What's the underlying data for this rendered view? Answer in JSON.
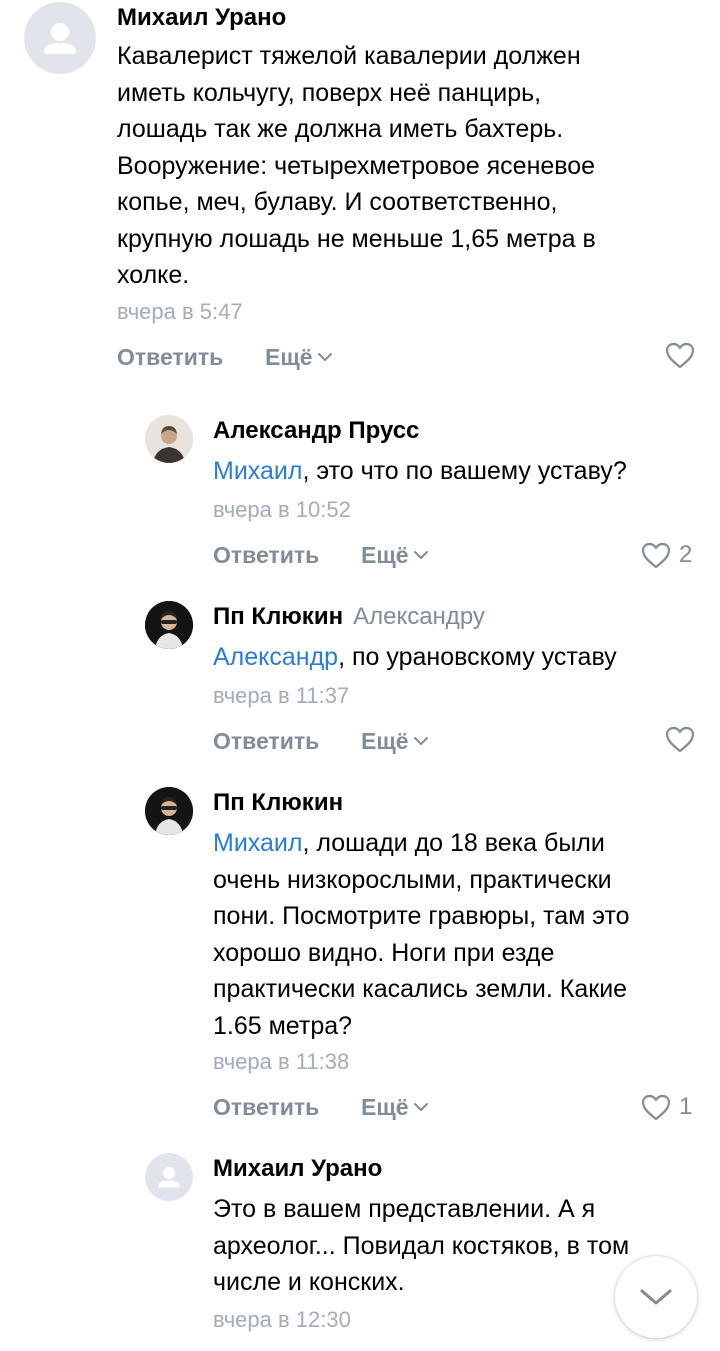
{
  "comments": [
    {
      "author": "Михаил Урано",
      "lines": [
        "Кавалерист тяжелой кавалерии должен",
        "иметь кольчугу, поверх неё панцирь,",
        "лошадь так же должна иметь бахтерь.",
        "Вооружение: четырехметровое ясеневое",
        "копье, меч, булаву. И соответственно,",
        "крупную лошадь не меньше 1,65 метра в",
        "холке."
      ],
      "time": "вчера в 5:47",
      "reply_label": "Ответить",
      "more_label": "Ещё",
      "likes": ""
    },
    {
      "author": "Александр Прусс",
      "mention": "Михаил",
      "text": ", это что по вашему уставу?",
      "time": "вчера в 10:52",
      "reply_label": "Ответить",
      "more_label": "Ещё",
      "likes": "2"
    },
    {
      "author": "Пп Клюкин",
      "reply_to": "Александру",
      "mention": "Александр",
      "text": ", по урановскому уставу",
      "time": "вчера в 11:37",
      "reply_label": "Ответить",
      "more_label": "Ещё",
      "likes": ""
    },
    {
      "author": "Пп Клюкин",
      "mention": "Михаил",
      "line1_rest": ", лошади до 18 века были",
      "lines": [
        "очень низкорослыми, практически",
        "пони. Посмотрите гравюры, там это",
        "хорошо видно. Ноги при езде",
        "практически касались земли. Какие",
        "1.65 метра?"
      ],
      "time": "вчера в 11:38",
      "reply_label": "Ответить",
      "more_label": "Ещё",
      "likes": "1"
    },
    {
      "author": "Михаил Урано",
      "lines": [
        "Это в вашем представлении. А я",
        "археолог... Повидал костяков, в том",
        "числе и конских."
      ],
      "time": "вчера в 12:30"
    }
  ],
  "icons": {
    "like": "heart-outline-icon",
    "more": "chevron-down-icon",
    "scroll_down": "chevron-down-icon",
    "default_avatar": "user-silhouette-icon"
  },
  "colors": {
    "mention": "#2a7dd5",
    "secondary": "#818c99",
    "timestamp": "#a3acb8"
  }
}
